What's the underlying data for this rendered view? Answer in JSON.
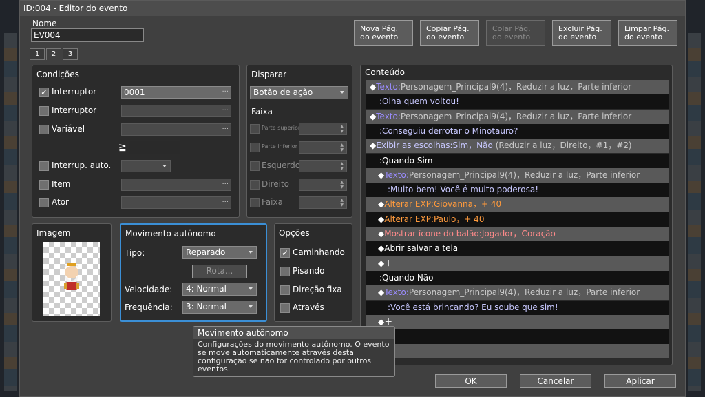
{
  "window": {
    "title": "ID:004 - Editor do evento"
  },
  "name": {
    "label": "Nome",
    "value": "EV004"
  },
  "page_buttons": [
    {
      "l1": "Nova Pág.",
      "l2": "do evento",
      "enabled": true
    },
    {
      "l1": "Copiar Pág.",
      "l2": "do evento",
      "enabled": true
    },
    {
      "l1": "Colar Pág.",
      "l2": "do evento",
      "enabled": false
    },
    {
      "l1": "Excluir Pág.",
      "l2": "do evento",
      "enabled": true
    },
    {
      "l1": "Limpar Pág.",
      "l2": "do evento",
      "enabled": true
    }
  ],
  "tabs": [
    "1",
    "2",
    "3"
  ],
  "conditions": {
    "title": "Condições",
    "items": [
      {
        "label": "Interruptor",
        "checked": true,
        "value": "0001"
      },
      {
        "label": "Interruptor",
        "checked": false,
        "value": ""
      },
      {
        "label": "Variável",
        "checked": false,
        "value": ""
      },
      {
        "label": "Interrup. auto.",
        "checked": false,
        "value": ""
      },
      {
        "label": "Item",
        "checked": false,
        "value": ""
      },
      {
        "label": "Ator",
        "checked": false,
        "value": ""
      }
    ],
    "gte_symbol": "≧"
  },
  "trigger": {
    "title": "Disparar",
    "value": "Botão de ação",
    "range_title": "Faixa",
    "options": [
      "Parte superior",
      "Parte inferior",
      "Esquerdo",
      "Direito",
      "Faixa"
    ]
  },
  "image": {
    "title": "Imagem"
  },
  "autonomous": {
    "title": "Movimento autônomo",
    "type_label": "Tipo:",
    "type_value": "Reparado",
    "route_label": "Rota...",
    "speed_label": "Velocidade:",
    "speed_value": "4: Normal",
    "freq_label": "Frequência:",
    "freq_value": "3: Normal"
  },
  "options": {
    "title": "Opções",
    "items": [
      {
        "label": "Caminhando",
        "checked": true
      },
      {
        "label": "Pisando",
        "checked": false
      },
      {
        "label": "Direção fixa",
        "checked": false
      },
      {
        "label": "Através",
        "checked": false
      }
    ]
  },
  "content": {
    "title": "Conteúdo",
    "rows": [
      {
        "bg": "g",
        "ind": 0,
        "parts": [
          [
            "◆",
            "w"
          ],
          [
            "Texto:",
            "p"
          ],
          [
            "Personagem_Principal9(4)，Reduzir a luz，Parte inferior",
            "g"
          ]
        ]
      },
      {
        "bg": "d",
        "ind": 1,
        "parts": [
          [
            ":Olha quem voltou!",
            "l"
          ]
        ]
      },
      {
        "bg": "g",
        "ind": 0,
        "parts": [
          [
            "◆",
            "w"
          ],
          [
            "Texto:",
            "p"
          ],
          [
            "Personagem_Principal9(4)，Reduzir a luz，Parte inferior",
            "g"
          ]
        ]
      },
      {
        "bg": "d",
        "ind": 1,
        "parts": [
          [
            ":Conseguiu derrotar o Minotauro?",
            "l"
          ]
        ]
      },
      {
        "bg": "g",
        "ind": 0,
        "parts": [
          [
            "◆",
            "w"
          ],
          [
            "Exibir as escolhas:Sim，Não",
            "l"
          ],
          [
            " (Reduzir a luz，Direito，#1，#2)",
            "g"
          ]
        ]
      },
      {
        "bg": "d",
        "ind": 1,
        "parts": [
          [
            ":Quando Sim",
            "w"
          ]
        ]
      },
      {
        "bg": "g",
        "ind": 2,
        "parts": [
          [
            "◆",
            "w"
          ],
          [
            "Texto:",
            "p"
          ],
          [
            "Personagem_Principal9(4)，Reduzir a luz，Parte inferior",
            "g"
          ]
        ]
      },
      {
        "bg": "d",
        "ind": 3,
        "parts": [
          [
            ":Muito bem! Você é muito poderosa!",
            "l"
          ]
        ]
      },
      {
        "bg": "g",
        "ind": 2,
        "parts": [
          [
            "◆",
            "w"
          ],
          [
            "Alterar EXP:Giovanna，+ 40",
            "o"
          ]
        ]
      },
      {
        "bg": "d",
        "ind": 2,
        "parts": [
          [
            "◆",
            "w"
          ],
          [
            "Alterar EXP:Paulo，+ 40",
            "o"
          ]
        ]
      },
      {
        "bg": "g",
        "ind": 2,
        "parts": [
          [
            "◆",
            "w"
          ],
          [
            "Mostrar ícone do balão:Jogador，Coração",
            "r"
          ]
        ]
      },
      {
        "bg": "d",
        "ind": 2,
        "parts": [
          [
            "◆",
            "w"
          ],
          [
            "Abrir salvar a tela",
            "w"
          ]
        ]
      },
      {
        "bg": "g",
        "ind": 2,
        "parts": [
          [
            "◆＋",
            "w"
          ]
        ]
      },
      {
        "bg": "d",
        "ind": 1,
        "parts": [
          [
            ":Quando Não",
            "w"
          ]
        ]
      },
      {
        "bg": "g",
        "ind": 2,
        "parts": [
          [
            "◆",
            "w"
          ],
          [
            "Texto:",
            "p"
          ],
          [
            "Personagem_Principal9(4)，Reduzir a luz，Parte inferior",
            "g"
          ]
        ]
      },
      {
        "bg": "d",
        "ind": 3,
        "parts": [
          [
            ":Você está brincando? Eu soube que sim!",
            "l"
          ]
        ]
      },
      {
        "bg": "g",
        "ind": 2,
        "parts": [
          [
            "◆＋",
            "w"
          ]
        ]
      },
      {
        "bg": "d",
        "ind": 0,
        "parts": []
      },
      {
        "bg": "g",
        "ind": 0,
        "parts": []
      }
    ]
  },
  "tooltip": {
    "title": "Movimento autônomo",
    "body": "Configurações do movimento autônomo. O evento se move automaticamente através desta configuração se não for controlado por outros eventos."
  },
  "footer": {
    "ok": "OK",
    "cancel": "Cancelar",
    "apply": "Aplicar"
  }
}
